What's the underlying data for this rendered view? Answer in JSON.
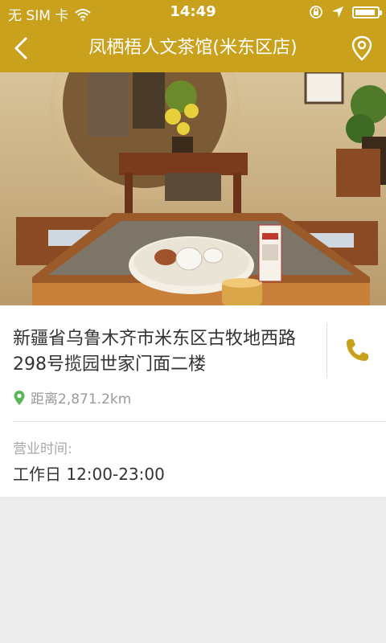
{
  "status_bar": {
    "carrier": "无 SIM 卡",
    "time": "14:49"
  },
  "nav": {
    "title": "凤栖梧人文茶馆(米东区店)",
    "back_icon": "chevron-left-icon",
    "location_icon": "location-pin-icon"
  },
  "store": {
    "address": "新疆省乌鲁木齐市米东区古牧地西路298号揽园世家门面二楼",
    "distance": "距离2,871.2km",
    "hours_label": "营业时间:",
    "hours": "工作日 12:00-23:00"
  },
  "colors": {
    "brand": "#c9a11d",
    "pin": "#5cb85c",
    "phone": "#c9a11d"
  }
}
